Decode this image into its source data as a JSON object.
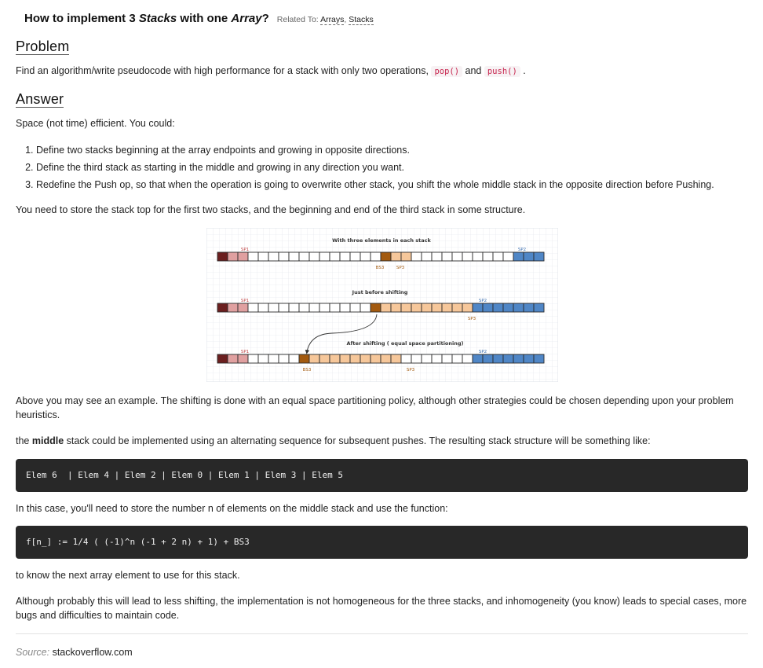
{
  "header": {
    "title_prefix": "How to implement 3 ",
    "title_em1": "Stacks",
    "title_mid": " with one ",
    "title_em2": "Array",
    "title_suffix": "?",
    "related_label": "Related To:",
    "related_links": [
      "Arrays",
      "Stacks"
    ],
    "related_sep": ", "
  },
  "problem": {
    "heading": "Problem",
    "text_before": "Find an algorithm/write pseudocode with high performance for a stack with only two operations, ",
    "code1": "pop()",
    "text_and": " and ",
    "code2": "push()",
    "text_end": " ."
  },
  "answer": {
    "heading": "Answer",
    "intro": "Space (not time) efficient. You could:",
    "steps": [
      "Define two stacks beginning at the array endpoints and growing in opposite directions.",
      "Define the third stack as starting in the middle and growing in any direction you want.",
      "Redefine the Push op, so that when the operation is going to overwrite other stack, you shift the whole middle stack in the opposite direction before Pushing."
    ],
    "store_text": "You need to store the stack top for the first two stacks, and the beginning and end of the third stack in some structure.",
    "diagram": {
      "label_row1": "With three elements in each stack",
      "label_row2": "Just before shifting",
      "label_row3": "After shifting ( equal space partitioning)",
      "sp1": "SP1",
      "sp2": "SP2",
      "sp3": "SP3",
      "bs3": "BS3"
    },
    "example_text": "Above you may see an example. The shifting is done with an equal space partitioning policy, although other strategies could be chosen depending upon your problem heuristics.",
    "middle_before": "the ",
    "middle_bold": "middle",
    "middle_after": " stack could be implemented using an alternating sequence for subsequent pushes. The resulting stack structure will be something like:",
    "code_block1": "Elem 6  | Elem 4 | Elem 2 | Elem 0 | Elem 1 | Elem 3 | Elem 5",
    "function_text": "In this case, you'll need to store the number n of elements on the middle stack and use the function:",
    "code_block2": "f[n_] := 1/4 ( (-1)^n (-1 + 2 n) + 1) + BS3",
    "know_text": "to know the next array element to use for this stack.",
    "conclusion": "Although probably this will lead to less shifting, the implementation is not homogeneous for the three stacks, and inhomogeneity (you know) leads to special cases, more bugs and difficulties to maintain code."
  },
  "footer": {
    "source_label": "Source:",
    "source_link": "stackoverflow.com"
  },
  "colors": {
    "stack1_dark": "#6b1f1f",
    "stack1_light": "#e0a0a0",
    "stack3_dark": "#a35a0f",
    "stack3_light": "#f6c79a",
    "stack2": "#4f86c6",
    "code_bg": "#282828",
    "inline_code": "#c7254e"
  }
}
